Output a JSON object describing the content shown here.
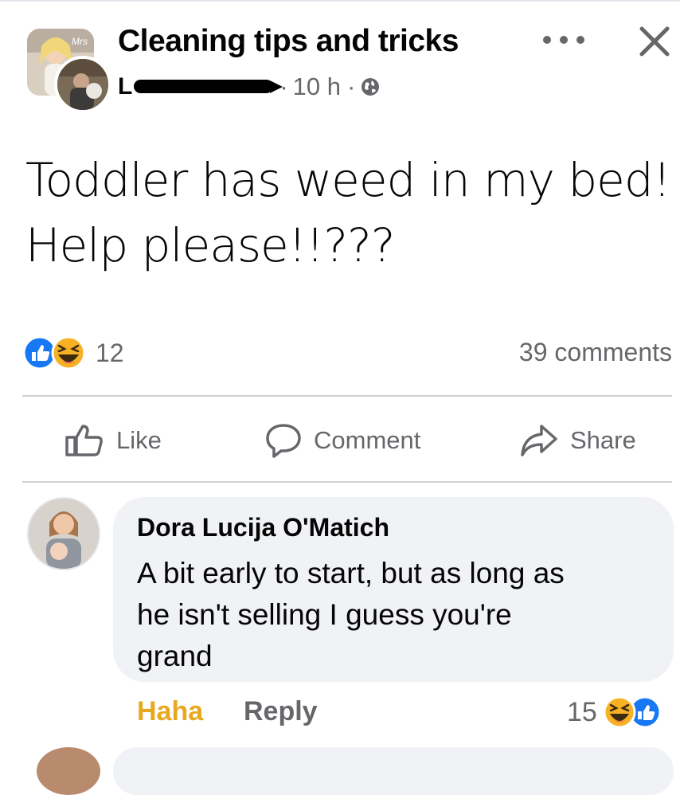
{
  "post": {
    "group_name": "Cleaning tips and tricks",
    "group_avatar_text": "Mrs",
    "author_initial": "L",
    "time": "10 h",
    "separator": "·",
    "privacy_icon": "globe-icon",
    "text_lines": [
      "Toddler has weed in my bed!",
      "Help please!!???"
    ]
  },
  "reactions": {
    "icons": [
      "like-icon",
      "haha-icon"
    ],
    "count": "12",
    "comments": "39 comments"
  },
  "actions": {
    "like": "Like",
    "comment": "Comment",
    "share": "Share"
  },
  "comment": {
    "author": "Dora Lucija O'Matich",
    "text_lines": [
      "A bit early to start, but as long as",
      "he isn't selling I guess you're",
      "grand"
    ],
    "haha_label": "Haha",
    "reply_label": "Reply",
    "reaction_count": "15",
    "reaction_icons": [
      "haha-icon",
      "like-icon"
    ]
  },
  "colors": {
    "like_blue": "#1877f2",
    "haha_yellow": "#f7b125",
    "haha_text": "#e8a81e",
    "secondary_text": "#65676b",
    "bubble_bg": "#f0f2f5"
  }
}
